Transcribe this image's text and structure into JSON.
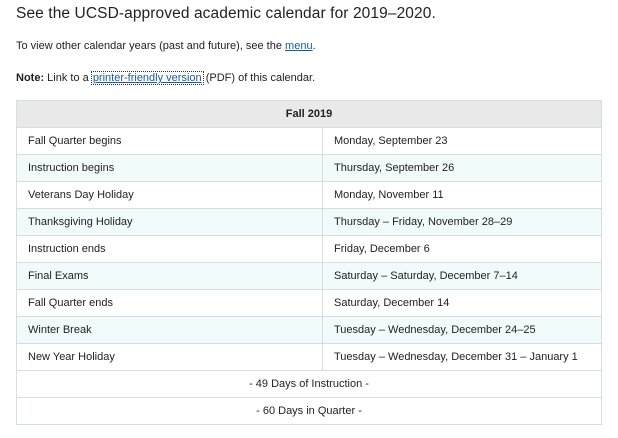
{
  "page": {
    "heading": "See the UCSD-approved academic calendar for 2019–2020.",
    "view_other_prefix": "To view other calendar years (past and future), see the ",
    "menu_link": "menu",
    "view_other_suffix": ".",
    "note_label": "Note:",
    "note_prefix": " Link to a ",
    "printer_link": "printer-friendly version",
    "note_suffix": " (PDF) of this calendar."
  },
  "calendar": {
    "term": "Fall 2019",
    "rows": [
      {
        "event": "Fall Quarter begins",
        "date": "Monday, September 23"
      },
      {
        "event": "Instruction begins",
        "date": "Thursday, September 26"
      },
      {
        "event": "Veterans Day Holiday",
        "date": "Monday, November 11"
      },
      {
        "event": "Thanksgiving Holiday",
        "date": "Thursday – Friday, November 28–29"
      },
      {
        "event": "Instruction ends",
        "date": "Friday, December 6"
      },
      {
        "event": "Final Exams",
        "date": "Saturday – Saturday, December 7–14"
      },
      {
        "event": "Fall Quarter ends",
        "date": "Saturday, December 14"
      },
      {
        "event": "Winter Break",
        "date": "Tuesday – Wednesday, December 24–25"
      },
      {
        "event": "New Year Holiday",
        "date": "Tuesday – Wednesday, December 31 – January 1"
      }
    ],
    "summary_instruction": "- 49 Days of Instruction -",
    "summary_quarter": "- 60 Days in Quarter -"
  },
  "colors": {
    "link": "#1a5a9c",
    "header_bg": "#e9e9e9",
    "alt_row_bg": "#f2fbfc",
    "border": "#d8dde0"
  }
}
